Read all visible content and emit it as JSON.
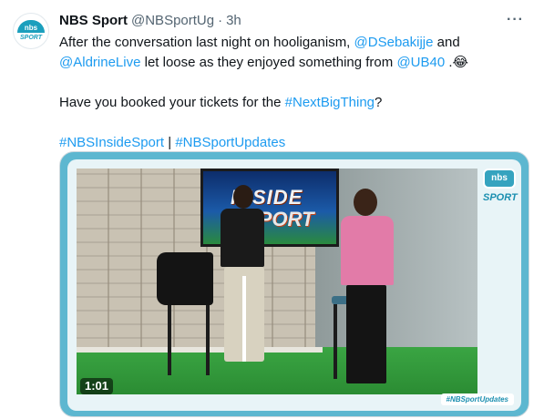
{
  "author": {
    "name": "NBS Sport",
    "handle": "@NBSportUg",
    "time": "3h",
    "avatar_text": "nbs",
    "avatar_sub": "SPORT"
  },
  "menu_icon": "more-horizontal-icon",
  "tweet": {
    "line1_pre": "After the conversation last night on hooliganism, ",
    "mention1": "@DSebakijje",
    "line1_mid": " and",
    "mention2": "@AldrineLive",
    "line2_mid": " let loose as they enjoyed something from ",
    "mention3": "@UB40",
    "line2_post": " .😂",
    "line3_pre": "Have you booked your tickets for the ",
    "hashtag1": "#NextBigThing",
    "line3_post": "?",
    "hashtag2": "#NBSInsideSport",
    "separator": " | ",
    "hashtag3": "#NBSportUpdates"
  },
  "media": {
    "duration": "1:01",
    "screen_title_1": "INSIDE",
    "screen_title_2": "SPORT",
    "logo_text": "nbs",
    "logo_sub": "SPORT",
    "badge": "#NBSportUpdates",
    "frame_color": "#5db7d0"
  },
  "colors": {
    "link": "#1d9bf0",
    "text": "#0f1419",
    "muted": "#536471"
  }
}
